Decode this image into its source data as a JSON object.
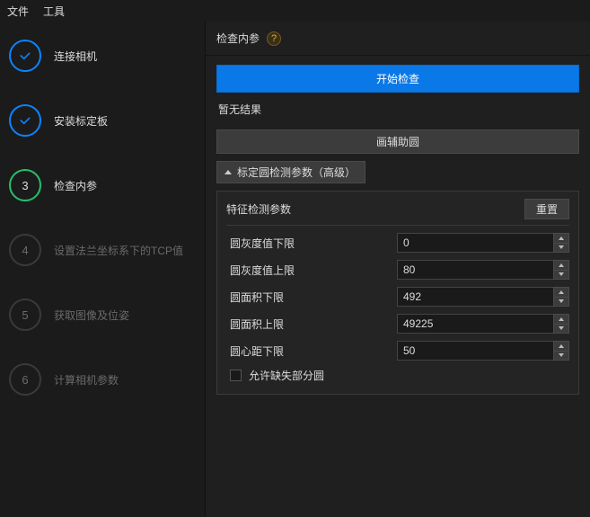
{
  "menu": {
    "file": "文件",
    "tools": "工具"
  },
  "steps": [
    {
      "label": "连接相机",
      "state": "done"
    },
    {
      "label": "安装标定板",
      "state": "done"
    },
    {
      "label": "检查内参",
      "state": "active",
      "num": "3"
    },
    {
      "label": "设置法兰坐标系下的TCP值",
      "state": "todo",
      "num": "4"
    },
    {
      "label": "获取图像及位姿",
      "state": "todo",
      "num": "5"
    },
    {
      "label": "计算相机参数",
      "state": "todo",
      "num": "6"
    }
  ],
  "panel": {
    "title": "检查内参",
    "help_glyph": "?",
    "start_btn": "开始检查",
    "no_result": "暂无结果",
    "aux_btn": "画辅助圆",
    "section_toggle": "标定圆检测参数（高级）",
    "params_title": "特征检测参数",
    "reset_btn": "重置",
    "rows": [
      {
        "label": "圆灰度值下限",
        "value": "0"
      },
      {
        "label": "圆灰度值上限",
        "value": "80"
      },
      {
        "label": "圆面积下限",
        "value": "492"
      },
      {
        "label": "圆面积上限",
        "value": "49225"
      },
      {
        "label": "圆心距下限",
        "value": "50"
      }
    ],
    "allow_missing_label": "允许缺失部分圆",
    "allow_missing_checked": false
  }
}
